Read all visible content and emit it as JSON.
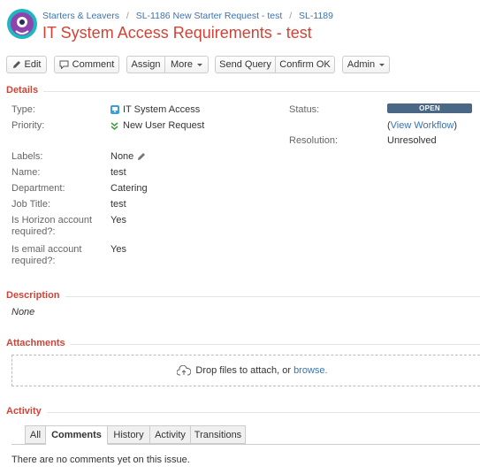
{
  "breadcrumb": {
    "items": [
      "Starters & Leavers",
      "SL-1186 New Starter Request - test",
      "SL-1189"
    ],
    "separator": "/"
  },
  "issue": {
    "title": "IT System Access Requirements - test"
  },
  "toolbar": {
    "edit": "Edit",
    "comment": "Comment",
    "assign": "Assign",
    "more": "More",
    "send_query": "Send Query",
    "confirm_ok": "Confirm OK",
    "admin": "Admin"
  },
  "details": {
    "heading": "Details",
    "type_label": "Type:",
    "type_value": "IT System Access",
    "priority_label": "Priority:",
    "priority_value": "New User Request",
    "status_label": "Status:",
    "status_value": "OPEN",
    "workflow_open": "(",
    "workflow_link": "View Workflow",
    "workflow_close": ")",
    "resolution_label": "Resolution:",
    "resolution_value": "Unresolved",
    "labels_label": "Labels:",
    "labels_value": "None",
    "name_label": "Name:",
    "name_value": "test",
    "department_label": "Department:",
    "department_value": "Catering",
    "job_title_label": "Job Title:",
    "job_title_value": "test",
    "horizon_label_1": "Is Horizon account",
    "horizon_label_2": "required?:",
    "horizon_value": "Yes",
    "email_label_1": "Is email account",
    "email_label_2": "required?:",
    "email_value": "Yes"
  },
  "description": {
    "heading": "Description",
    "value": "None"
  },
  "attachments": {
    "heading": "Attachments",
    "drop_text": "Drop files to attach, or",
    "browse_link": "browse."
  },
  "activity": {
    "heading": "Activity",
    "tabs": [
      "All",
      "Comments",
      "History",
      "Activity",
      "Transitions"
    ],
    "active_tab": "Comments",
    "empty_message": "There are no comments yet on this issue."
  },
  "colors": {
    "title": "#d04437",
    "link": "#3b73af",
    "status_lozenge": "#4a6785",
    "avatar_body": "#8e44ad",
    "avatar_ring": "#1fb5c1"
  },
  "icons": {
    "edit": "pencil-icon",
    "comment": "speech-bubble-icon",
    "type": "it-system-access-icon",
    "priority": "double-chevron-down-icon",
    "labels_edit": "pencil-icon",
    "upload": "cloud-upload-icon"
  }
}
